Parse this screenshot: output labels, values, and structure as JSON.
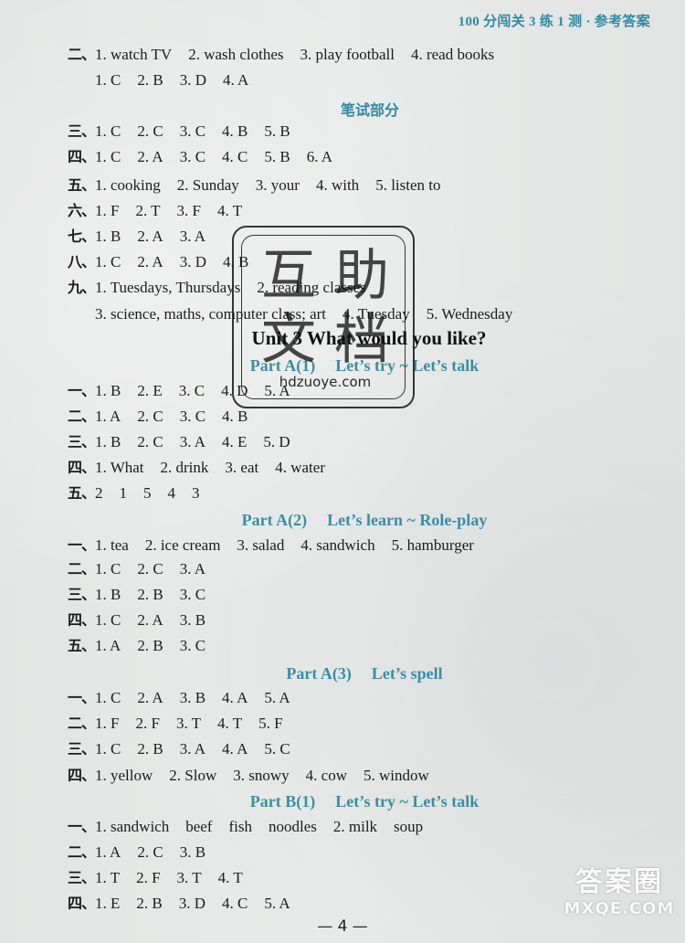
{
  "header": {
    "title": "100 分闯关 3 练 1 测 · 参考答案"
  },
  "sections": {
    "s1": {
      "num": "二、",
      "items": [
        "1. watch TV",
        "2. wash clothes",
        "3. play football",
        "4. read books"
      ]
    },
    "s1b": {
      "items": [
        "1. C",
        "2. B",
        "3. D",
        "4. A"
      ]
    },
    "written_heading": "笔试部分",
    "w3": {
      "num": "三、",
      "items": [
        "1. C",
        "2. C",
        "3. C",
        "4. B",
        "5. B"
      ]
    },
    "w4": {
      "num": "四、",
      "items": [
        "1. C",
        "2. A",
        "3. C",
        "4. C",
        "5. B",
        "6. A"
      ]
    },
    "w5": {
      "num": "五、",
      "items": [
        "1. cooking",
        "2. Sunday",
        "3. your",
        "4. with",
        "5. listen to"
      ]
    },
    "w6": {
      "num": "六、",
      "items": [
        "1. F",
        "2. T",
        "3. F",
        "4. T"
      ]
    },
    "w7": {
      "num": "七、",
      "items": [
        "1. B",
        "2. A",
        "3. A"
      ]
    },
    "w8": {
      "num": "八、",
      "items": [
        "1. C",
        "2. A",
        "3. D",
        "4. B"
      ]
    },
    "w9": {
      "num": "九、",
      "items": [
        "1. Tuesdays, Thursdays",
        "2. reading classes"
      ]
    },
    "w9b": {
      "items": [
        "3. science, maths, computer class; art",
        "4. Tuesday",
        "5. Wednesday"
      ]
    }
  },
  "unit": {
    "title": "Unit 3  What would you like?"
  },
  "partA1": {
    "title": "Part A(1)",
    "subtitle": "Let’s try ~ Let’s talk",
    "r1": {
      "num": "一、",
      "items": [
        "1. B",
        "2. E",
        "3. C",
        "4. D",
        "5. A"
      ]
    },
    "r2": {
      "num": "二、",
      "items": [
        "1. A",
        "2. C",
        "3. C",
        "4. B"
      ]
    },
    "r3": {
      "num": "三、",
      "items": [
        "1. B",
        "2. C",
        "3. A",
        "4. E",
        "5. D"
      ]
    },
    "r4": {
      "num": "四、",
      "items": [
        "1. What",
        "2. drink",
        "3. eat",
        "4. water"
      ]
    },
    "r5": {
      "num": "五、",
      "items": [
        "2",
        "1",
        "5",
        "4",
        "3"
      ]
    }
  },
  "partA2": {
    "title": "Part A(2)",
    "subtitle": "Let’s learn ~ Role-play",
    "r1": {
      "num": "一、",
      "items": [
        "1. tea",
        "2. ice cream",
        "3. salad",
        "4. sandwich",
        "5. hamburger"
      ]
    },
    "r2": {
      "num": "二、",
      "items": [
        "1. C",
        "2. C",
        "3. A"
      ]
    },
    "r3": {
      "num": "三、",
      "items": [
        "1. B",
        "2. B",
        "3. C"
      ]
    },
    "r4": {
      "num": "四、",
      "items": [
        "1. C",
        "2. A",
        "3. B"
      ]
    },
    "r5": {
      "num": "五、",
      "items": [
        "1. A",
        "2. B",
        "3. C"
      ]
    }
  },
  "partA3": {
    "title": "Part A(3)",
    "subtitle": "Let’s spell",
    "r1": {
      "num": "一、",
      "items": [
        "1. C",
        "2. A",
        "3. B",
        "4. A",
        "5. A"
      ]
    },
    "r2": {
      "num": "二、",
      "items": [
        "1. F",
        "2. F",
        "3. T",
        "4. T",
        "5. F"
      ]
    },
    "r3": {
      "num": "三、",
      "items": [
        "1. C",
        "2. B",
        "3. A",
        "4. A",
        "5. C"
      ]
    },
    "r4": {
      "num": "四、",
      "items": [
        "1. yellow",
        "2. Slow",
        "3. snowy",
        "4. cow",
        "5. window"
      ]
    }
  },
  "partB1": {
    "title": "Part B(1)",
    "subtitle": "Let’s try ~ Let’s talk",
    "r1": {
      "num": "一、",
      "items": [
        "1. sandwich",
        "beef",
        "fish",
        "noodles",
        "2. milk",
        "soup"
      ]
    },
    "r2": {
      "num": "二、",
      "items": [
        "1. A",
        "2. C",
        "3. B"
      ]
    },
    "r3": {
      "num": "三、",
      "items": [
        "1. T",
        "2. F",
        "3. T",
        "4. T"
      ]
    },
    "r4": {
      "num": "四、",
      "items": [
        "1. E",
        "2. B",
        "3. D",
        "4. C",
        "5. A"
      ]
    }
  },
  "page_number": "— 4 —",
  "watermarks": {
    "stamp_chars": "互助文档",
    "stamp_url": "hdzuoye.com",
    "corner_cn": "答案圈",
    "corner_en": "MXQE.COM"
  }
}
